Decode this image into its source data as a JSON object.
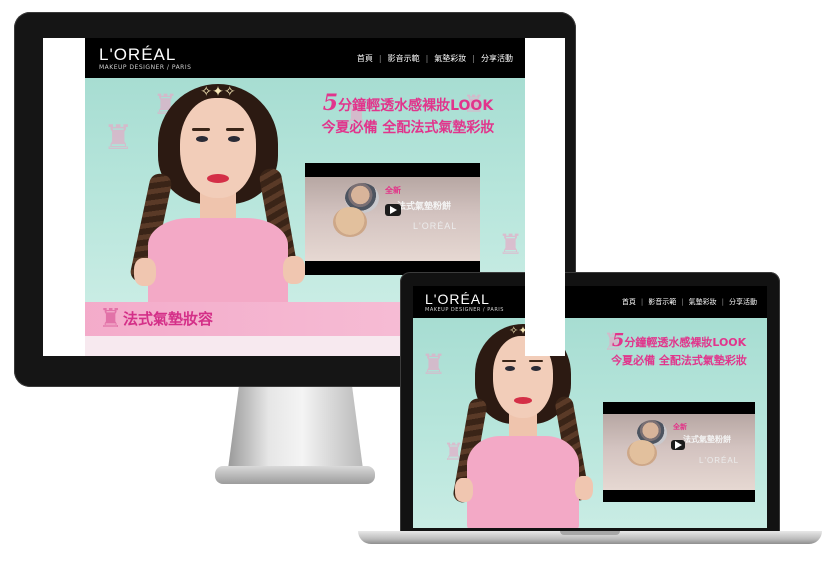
{
  "brand": {
    "logo_text": "L'ORÉAL",
    "logo_sub": "MAKEUP DESIGNER / PARIS"
  },
  "nav": [
    {
      "label": "首頁"
    },
    {
      "label": "影音示範"
    },
    {
      "label": "氣墊彩妝"
    },
    {
      "label": "分享活動"
    }
  ],
  "hero": {
    "headline_num": "5",
    "headline_line1_rest": "分鐘輕透水感裸妝LOOK",
    "headline_line2": "今夏必備 全配法式氣墊彩妝"
  },
  "video": {
    "tag": "全新",
    "title": "法式氣墊粉餅",
    "logo": "L'ORÉAL",
    "play_label": "▶"
  },
  "section": {
    "title": "法式氣墊妝容"
  },
  "colors": {
    "accent_pink": "#e1358c",
    "header_black": "#000000",
    "hero_mint": "#a9ddd3"
  },
  "icons": {
    "play": "play-icon",
    "eiffel": "eiffel-tower-icon"
  }
}
